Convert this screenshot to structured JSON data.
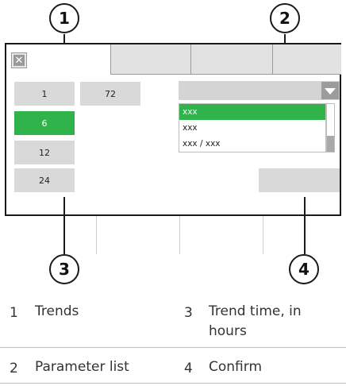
{
  "callouts": {
    "c1": "1",
    "c2": "2",
    "c3": "3",
    "c4": "4"
  },
  "screen": {
    "close_icon": "close-icon",
    "trend_time_buttons": [
      "1",
      "6",
      "12",
      "24",
      "72"
    ],
    "selected_trend_time": "6",
    "parameter_list": {
      "items": [
        "xxx",
        "xxx",
        "xxx / xxx"
      ],
      "selected_index": 0
    },
    "colors": {
      "selected": "#2fb34a",
      "button": "#d9d9d9",
      "frame": "#1a1a1a"
    }
  },
  "legend": [
    {
      "num": "1",
      "text": "Trends"
    },
    {
      "num": "3",
      "text": "Trend time, in hours"
    },
    {
      "num": "2",
      "text": "Parameter list"
    },
    {
      "num": "4",
      "text": "Confirm"
    }
  ]
}
